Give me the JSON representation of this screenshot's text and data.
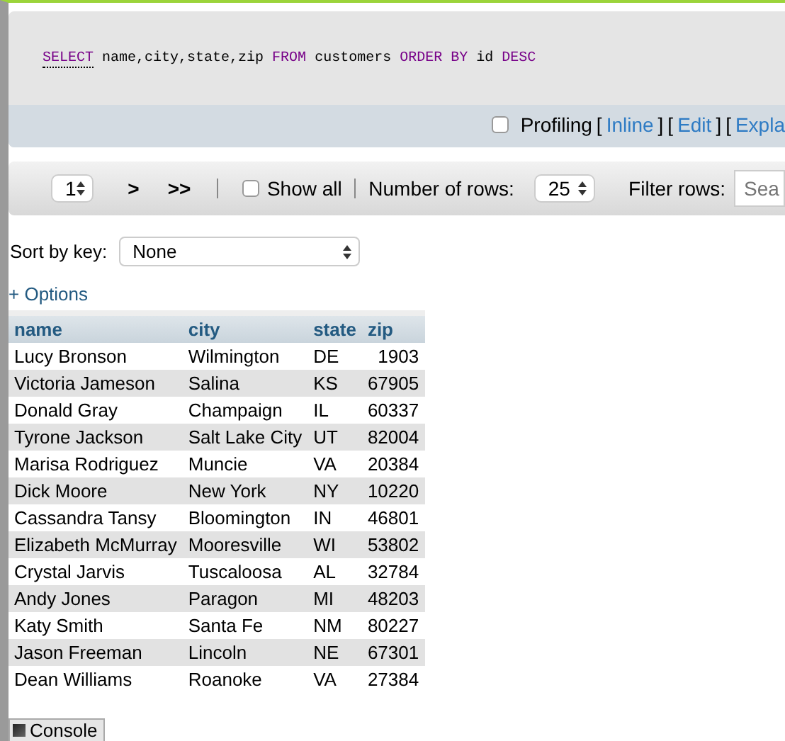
{
  "query": {
    "tokens": [
      {
        "text": "SELECT",
        "kind": "keyword"
      },
      {
        "text": "name,city,state,zip",
        "kind": "plain"
      },
      {
        "text": "FROM",
        "kind": "keyword"
      },
      {
        "text": "customers",
        "kind": "plain"
      },
      {
        "text": "ORDER BY",
        "kind": "keyword"
      },
      {
        "text": "id",
        "kind": "plain"
      },
      {
        "text": "DESC",
        "kind": "keyword"
      }
    ]
  },
  "profiling": {
    "label": "Profiling",
    "checked": false,
    "links": [
      {
        "open": "[",
        "text": "Inline",
        "close": "]"
      },
      {
        "open": "[",
        "text": "Edit",
        "close": "]"
      },
      {
        "open": "[",
        "text": "Expla"
      }
    ]
  },
  "navigation": {
    "page": "1",
    "next": ">",
    "last": ">>",
    "show_all": {
      "label": "Show all",
      "checked": false
    },
    "rows_label": "Number of rows:",
    "rows": "25",
    "filter_label": "Filter rows:",
    "filter_placeholder": "Sea"
  },
  "sort": {
    "label": "Sort by key:",
    "value": "None"
  },
  "options_link": "+ Options",
  "table": {
    "columns": [
      "name",
      "city",
      "state",
      "zip"
    ],
    "rows": [
      [
        "Lucy Bronson",
        "Wilmington",
        "DE",
        "1903"
      ],
      [
        "Victoria Jameson",
        "Salina",
        "KS",
        "67905"
      ],
      [
        "Donald Gray",
        "Champaign",
        "IL",
        "60337"
      ],
      [
        "Tyrone Jackson",
        "Salt Lake City",
        "UT",
        "82004"
      ],
      [
        "Marisa Rodriguez",
        "Muncie",
        "VA",
        "20384"
      ],
      [
        "Dick Moore",
        "New York",
        "NY",
        "10220"
      ],
      [
        "Cassandra Tansy",
        "Bloomington",
        "IN",
        "46801"
      ],
      [
        "Elizabeth McMurray",
        "Mooresville",
        "WI",
        "53802"
      ],
      [
        "Crystal Jarvis",
        "Tuscaloosa",
        "AL",
        "32784"
      ],
      [
        "Andy Jones",
        "Paragon",
        "MI",
        "48203"
      ],
      [
        "Katy Smith",
        "Santa Fe",
        "NM",
        "80227"
      ],
      [
        "Jason Freeman",
        "Lincoln",
        "NE",
        "67301"
      ],
      [
        "Dean Williams",
        "Roanoke",
        "VA",
        "27384"
      ]
    ]
  },
  "console": {
    "label": "Console"
  }
}
